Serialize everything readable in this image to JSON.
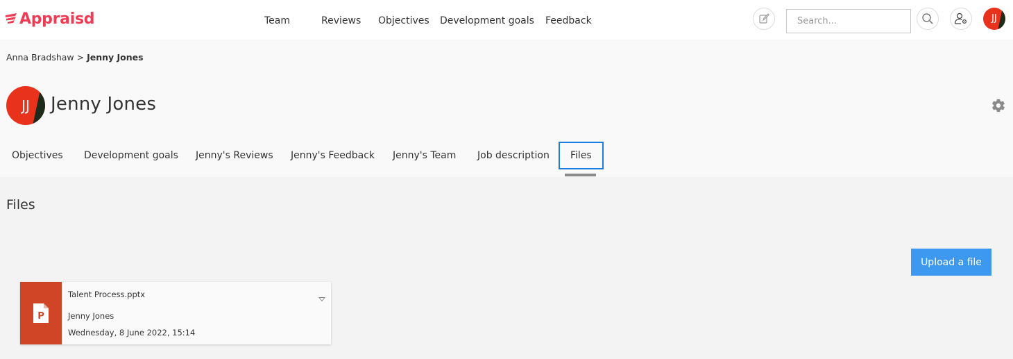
{
  "brand": {
    "name": "Appraisd",
    "color": "#ef3c55"
  },
  "topnav": [
    "Team",
    "Reviews",
    "Objectives",
    "Development goals",
    "Feedback"
  ],
  "search": {
    "placeholder": "Search..."
  },
  "user_avatar": {
    "initials": "JJ"
  },
  "breadcrumb": {
    "parent": "Anna Bradshaw",
    "separator": ">",
    "current": "Jenny Jones"
  },
  "profile": {
    "initials": "JJ",
    "name": "Jenny Jones"
  },
  "tabs": [
    {
      "label": "Objectives"
    },
    {
      "label": "Development goals"
    },
    {
      "label": "Jenny's Reviews"
    },
    {
      "label": "Jenny's Feedback"
    },
    {
      "label": "Jenny's Team"
    },
    {
      "label": "Job description"
    },
    {
      "label": "Files",
      "active": true
    }
  ],
  "files_section": {
    "title": "Files",
    "upload_label": "Upload a file",
    "files": [
      {
        "name": "Talent Process.pptx",
        "owner": "Jenny Jones",
        "date": "Wednesday, 8 June 2022, 15:14",
        "type_icon": "powerpoint-file-icon",
        "thumb_color": "#d04526"
      }
    ]
  },
  "colors": {
    "accent": "#3d98f0",
    "active_tab_border": "#1a7fe0",
    "avatar": "#e8321c"
  }
}
